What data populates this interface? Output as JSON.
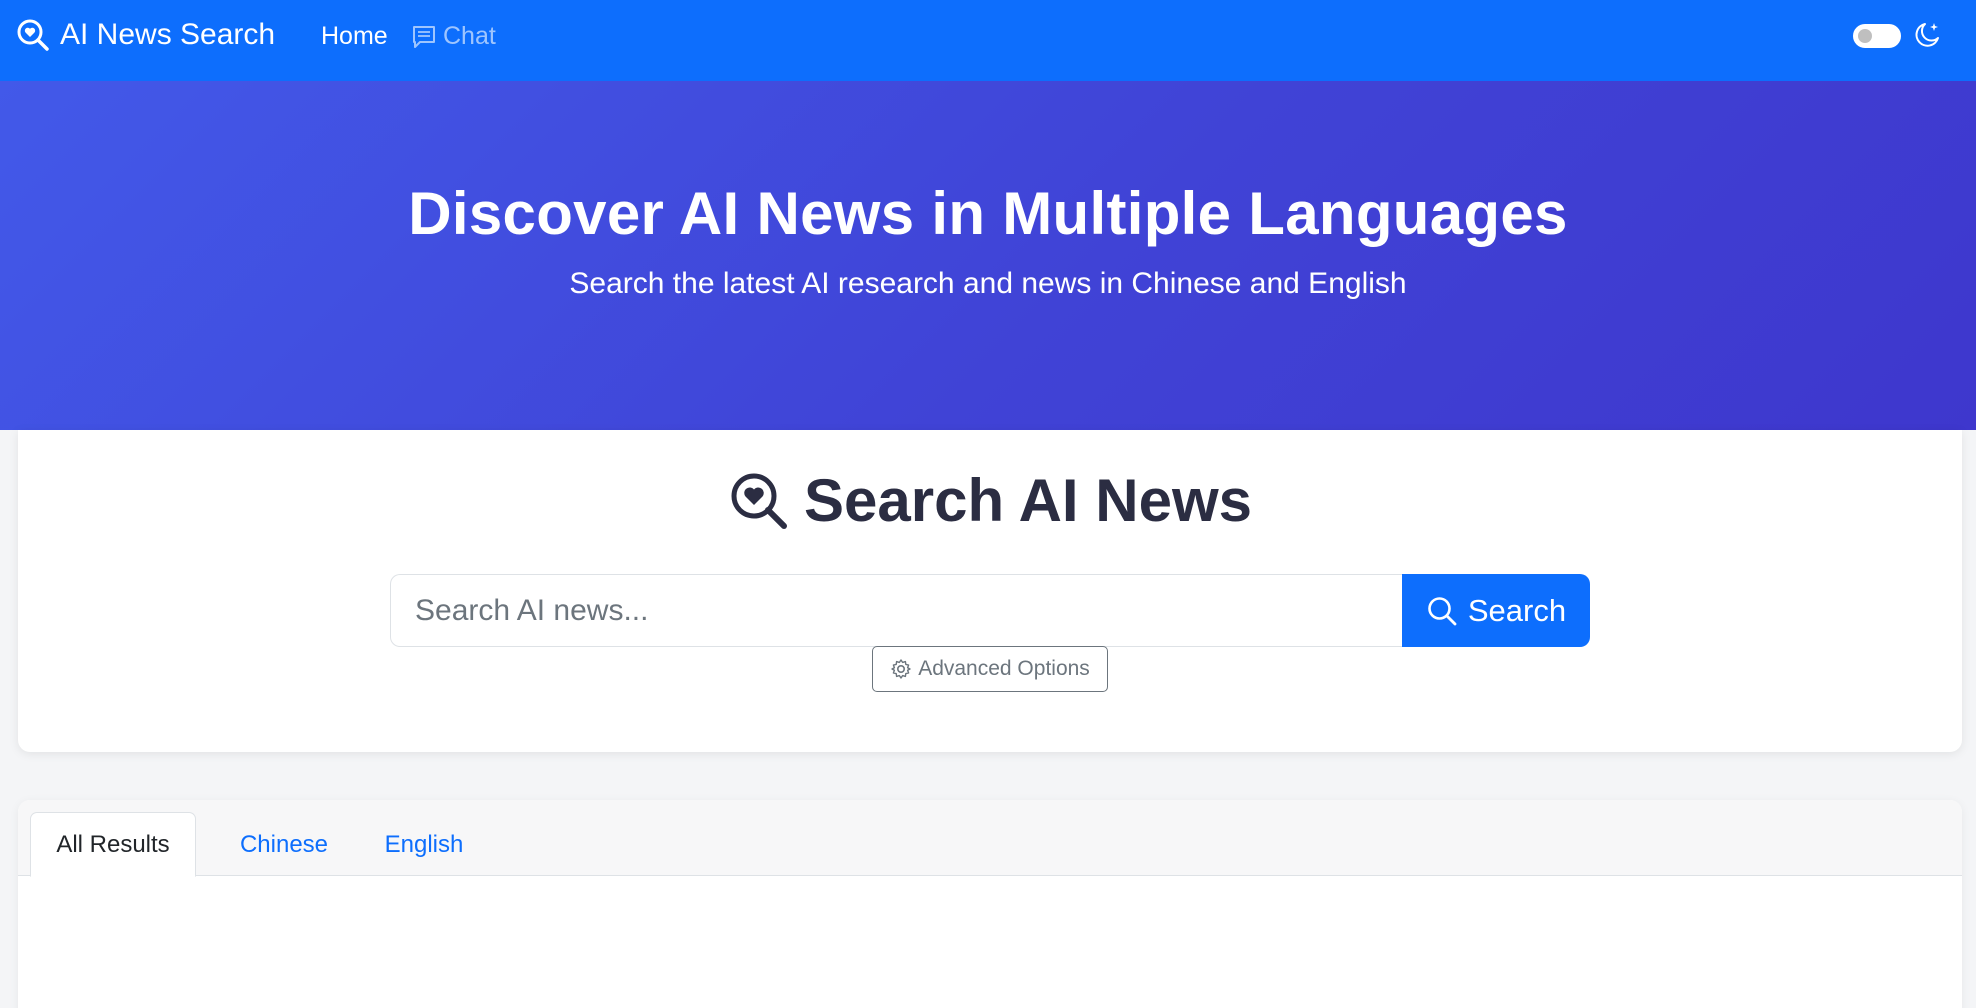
{
  "navbar": {
    "brand": "AI News Search",
    "links": [
      {
        "label": "Home"
      },
      {
        "label": "Chat"
      }
    ]
  },
  "hero": {
    "title": "Discover AI News in Multiple Languages",
    "subtitle": "Search the latest AI research and news in Chinese and English"
  },
  "search": {
    "title": "Search AI News",
    "placeholder": "Search AI news...",
    "button_label": "Search",
    "advanced_label": "Advanced Options"
  },
  "results": {
    "tabs": [
      {
        "label": "All Results"
      },
      {
        "label": "Chinese"
      },
      {
        "label": "English"
      }
    ]
  },
  "colors": {
    "primary": "#0d6efd",
    "hero_start": "#4259e9",
    "hero_end": "#3e37cd",
    "title_text": "#2b2d42"
  }
}
